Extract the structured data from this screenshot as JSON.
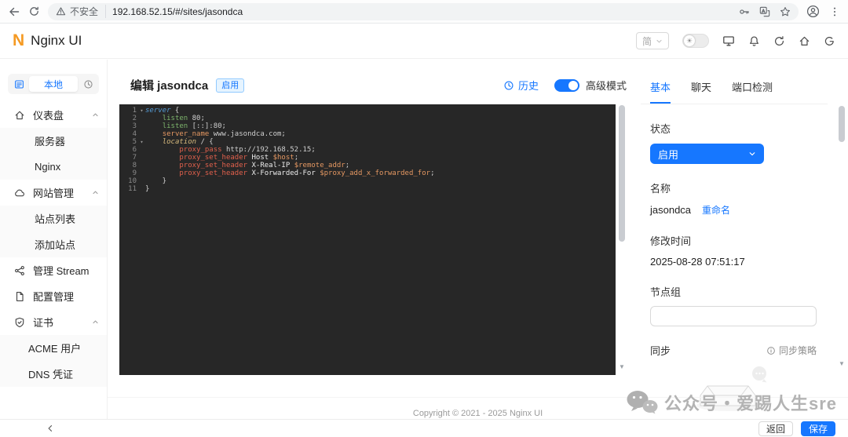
{
  "browser": {
    "security_label": "不安全",
    "url": "192.168.52.15/#/sites/jasondca"
  },
  "app_header": {
    "logo_letter": "N",
    "logo_text": "Nginx UI",
    "lang_selected": "简"
  },
  "sidebar": {
    "env_label": "本地",
    "items": {
      "dashboard": "仪表盘",
      "server": "服务器",
      "nginx": "Nginx",
      "site_mgmt": "网站管理",
      "site_list": "站点列表",
      "site_add": "添加站点",
      "stream": "管理 Stream",
      "config": "配置管理",
      "cert": "证书",
      "acme": "ACME 用户",
      "dns": "DNS 凭证"
    }
  },
  "page": {
    "title": "编辑 jasondca",
    "enabled_badge": "启用",
    "history_label": "历史",
    "advanced_mode_label": "高级模式"
  },
  "editor": {
    "lines": [
      {
        "n": 1,
        "fold": true,
        "tokens": [
          [
            "server",
            "blk"
          ],
          [
            " {",
            "pln"
          ]
        ]
      },
      {
        "n": 2,
        "fold": false,
        "tokens": [
          [
            "    ",
            "pln"
          ],
          [
            "listen",
            "dir"
          ],
          [
            " 80;",
            "pln"
          ]
        ]
      },
      {
        "n": 3,
        "fold": false,
        "tokens": [
          [
            "    ",
            "pln"
          ],
          [
            "listen",
            "dir"
          ],
          [
            " [::]:80;",
            "pln"
          ]
        ]
      },
      {
        "n": 4,
        "fold": false,
        "tokens": [
          [
            "    ",
            "pln"
          ],
          [
            "server_name",
            "dir2"
          ],
          [
            " www.jasondca.com;",
            "pln"
          ]
        ]
      },
      {
        "n": 5,
        "fold": true,
        "tokens": [
          [
            "    ",
            "pln"
          ],
          [
            "location",
            "loc"
          ],
          [
            " / {",
            "pln"
          ]
        ]
      },
      {
        "n": 6,
        "fold": false,
        "tokens": [
          [
            "        ",
            "pln"
          ],
          [
            "proxy_pass",
            "dir3"
          ],
          [
            " http://192.168.52.15;",
            "pln"
          ]
        ]
      },
      {
        "n": 7,
        "fold": false,
        "tokens": [
          [
            "        ",
            "pln"
          ],
          [
            "proxy_set_header",
            "dir3"
          ],
          [
            " ",
            "pln"
          ],
          [
            "Host",
            "arg"
          ],
          [
            " ",
            "pln"
          ],
          [
            "$host",
            "var"
          ],
          [
            ";",
            "pln"
          ]
        ]
      },
      {
        "n": 8,
        "fold": false,
        "tokens": [
          [
            "        ",
            "pln"
          ],
          [
            "proxy_set_header",
            "dir3"
          ],
          [
            " ",
            "pln"
          ],
          [
            "X-Real-IP",
            "arg"
          ],
          [
            " ",
            "pln"
          ],
          [
            "$remote_addr",
            "var"
          ],
          [
            ";",
            "pln"
          ]
        ]
      },
      {
        "n": 9,
        "fold": false,
        "tokens": [
          [
            "        ",
            "pln"
          ],
          [
            "proxy_set_header",
            "dir3"
          ],
          [
            " ",
            "pln"
          ],
          [
            "X-Forwarded-For",
            "arg"
          ],
          [
            " ",
            "pln"
          ],
          [
            "$proxy_add_x_forwarded_for",
            "var"
          ],
          [
            ";",
            "pln"
          ]
        ]
      },
      {
        "n": 10,
        "fold": false,
        "tokens": [
          [
            "    }",
            "pln"
          ]
        ]
      },
      {
        "n": 11,
        "fold": false,
        "tokens": [
          [
            "}",
            "pln"
          ]
        ]
      }
    ]
  },
  "panel": {
    "tabs": {
      "basic": "基本",
      "chat": "聊天",
      "port": "端口检测"
    },
    "status_label": "状态",
    "status_value": "启用",
    "name_label": "名称",
    "name_value": "jasondca",
    "rename_label": "重命名",
    "modified_label": "修改时间",
    "modified_value": "2025-08-28 07:51:17",
    "node_group_label": "节点组",
    "sync_label": "同步",
    "sync_policy_label": "同步策略"
  },
  "footer": {
    "copyright": "Copyright © 2021 - 2025 Nginx UI",
    "watermark_text": "公众号・爱踢人生sre"
  },
  "actions": {
    "back": "返回",
    "save": "保存"
  },
  "colors": {
    "accent": "#1677ff",
    "editor_bg": "#272727"
  }
}
